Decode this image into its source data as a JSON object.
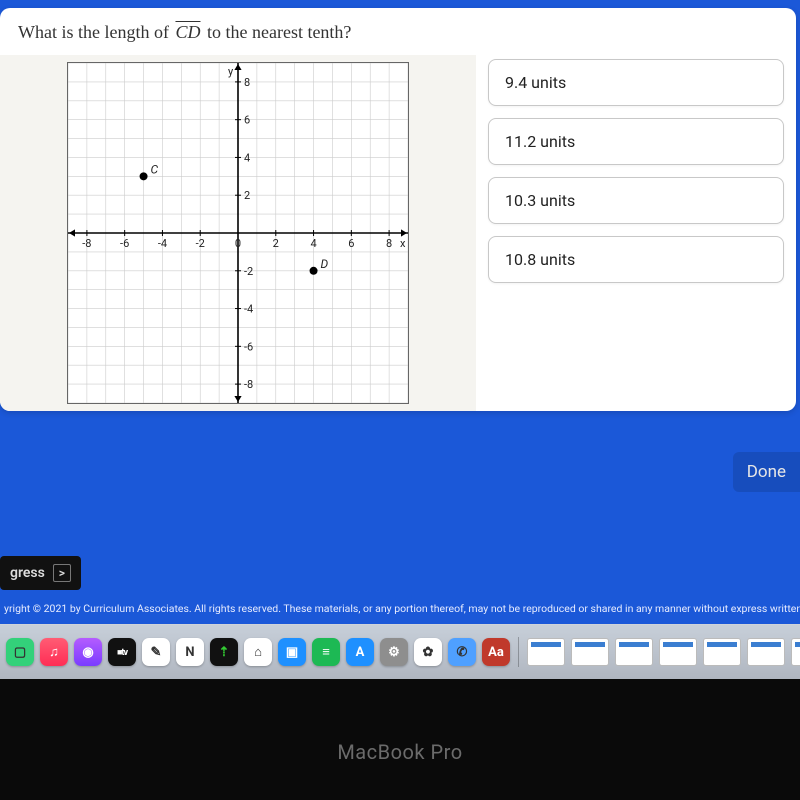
{
  "question": {
    "prefix": "What is the length of ",
    "segment": "CD",
    "suffix": " to the nearest tenth?"
  },
  "options": [
    {
      "label": "9.4 units"
    },
    {
      "label": "11.2 units"
    },
    {
      "label": "10.3 units"
    },
    {
      "label": "10.8 units"
    }
  ],
  "done_label": "Done",
  "progress_label": "gress",
  "copyright": "yright © 2021 by Curriculum Associates. All rights reserved. These materials, or any portion thereof, may not be reproduced or shared in any manner without express written consent of Curricu",
  "device_label": "MacBook Pro",
  "chart_data": {
    "type": "scatter",
    "points": [
      {
        "name": "C",
        "x": -5,
        "y": 3
      },
      {
        "name": "D",
        "x": 4,
        "y": -2
      }
    ],
    "xlabel": "x",
    "ylabel": "y",
    "xlim": [
      -9,
      9
    ],
    "ylim": [
      -9,
      9
    ],
    "xticks": [
      -8,
      -6,
      -4,
      -2,
      0,
      2,
      4,
      6,
      8
    ],
    "yticks": [
      -8,
      -6,
      -4,
      -2,
      2,
      4,
      6,
      8
    ]
  },
  "dock": {
    "apps": [
      "facetime",
      "music",
      "podcasts",
      "tv",
      "notes",
      "news",
      "stocks",
      "home",
      "keynote",
      "spotify",
      "appstore",
      "settings",
      "photos",
      "contacts",
      "dictionary"
    ],
    "docs": 7
  }
}
